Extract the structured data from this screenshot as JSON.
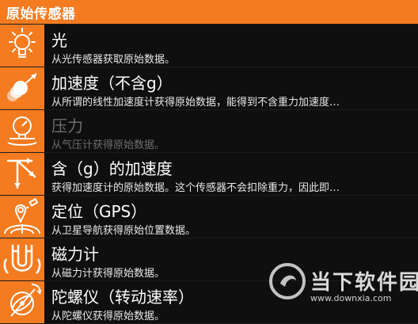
{
  "header": {
    "title": "原始传感器"
  },
  "sensors": [
    {
      "title": "光",
      "desc": "从光传感器获取原始数据。",
      "icon": "lightbulb-icon"
    },
    {
      "title": "加速度（不含g）",
      "desc": "从所谓的线性加速度计获得原始数据，能得到不含重力加速度…",
      "icon": "acceleration-icon"
    },
    {
      "title": "压力",
      "desc": "从气压计获得原始数据。",
      "icon": "pressure-gauge-icon"
    },
    {
      "title": "含（g）的加速度",
      "desc": "获得加速度计的原始数据。这个传感器不会扣除重力，因此即…",
      "icon": "gravity-acceleration-icon"
    },
    {
      "title": "定位（GPS）",
      "desc": "从卫星导航获得原始位置数据。",
      "icon": "gps-location-icon"
    },
    {
      "title": "磁力计",
      "desc": "从磁力计获得原始数据。",
      "icon": "magnet-icon"
    },
    {
      "title": "陀螺仪（转动速率）",
      "desc": "从陀螺仪获得原始数据。",
      "icon": "gyroscope-icon"
    }
  ],
  "watermark": {
    "name": "当下软件园",
    "url": "www.downxia.com"
  },
  "colors": {
    "accent": "#f47b20",
    "row_bg": "#0f0f0f",
    "disabled_text": "#6e6e6e"
  }
}
